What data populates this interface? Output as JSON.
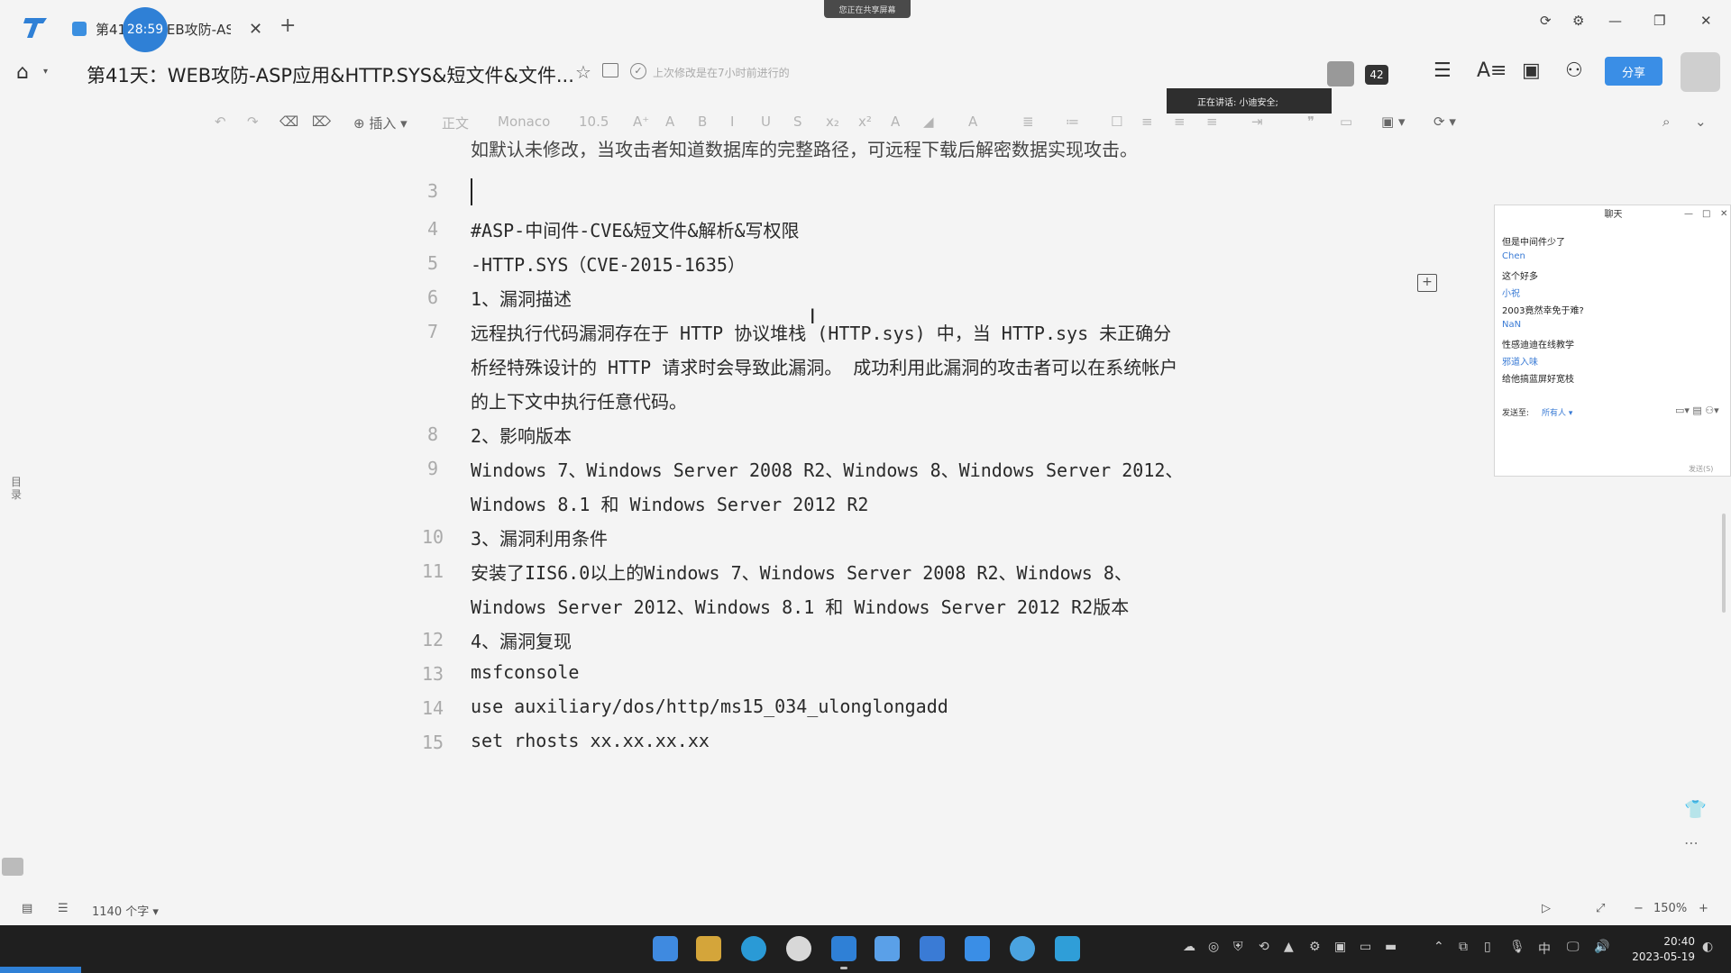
{
  "tabs": [
    {
      "title": "第41天：WEB攻防-ASP..."
    }
  ],
  "timer": "28:59",
  "share_indicator": "您正在共享屏幕",
  "doc": {
    "title": "第41天：WEB攻防-ASP应用&HTTP.SYS&短文件&文件...",
    "save_status": "上次修改是在7小时前进行的"
  },
  "speaking": "正在讲话: 小迪安全;",
  "participants_count": "42",
  "share_button": "分享",
  "toolbar": {
    "insert": "插入",
    "style": "正文",
    "font": "Monaco",
    "size": "10.5"
  },
  "editor": {
    "top_line": "如默认未修改，当攻击者知道数据库的完整路径，可远程下载后解密数据实现攻击。",
    "lines": [
      {
        "no": "3",
        "text": ""
      },
      {
        "no": "4",
        "text": "#ASP-中间件-CVE&短文件&解析&写权限"
      },
      {
        "no": "5",
        "text": "-HTTP.SYS（CVE-2015-1635）"
      },
      {
        "no": "6",
        "text": "1、漏洞描述"
      },
      {
        "no": "7",
        "text": "远程执行代码漏洞存在于 HTTP 协议堆栈 (HTTP.sys) 中，当 HTTP.sys 未正确分"
      },
      {
        "no": "",
        "text": "析经特殊设计的 HTTP 请求时会导致此漏洞。 成功利用此漏洞的攻击者可以在系统帐户"
      },
      {
        "no": "",
        "text": "的上下文中执行任意代码。"
      },
      {
        "no": "8",
        "text": "2、影响版本"
      },
      {
        "no": "9",
        "text": "Windows 7、Windows Server 2008 R2、Windows 8、Windows Server 2012、"
      },
      {
        "no": "",
        "text": "Windows 8.1 和 Windows Server 2012 R2"
      },
      {
        "no": "10",
        "text": "3、漏洞利用条件"
      },
      {
        "no": "11",
        "text": "安装了IIS6.0以上的Windows 7、Windows Server 2008 R2、Windows 8、"
      },
      {
        "no": "",
        "text": "Windows Server 2012、Windows 8.1 和 Windows Server 2012 R2版本"
      },
      {
        "no": "12",
        "text": "4、漏洞复现"
      },
      {
        "no": "13",
        "text": "msfconsole"
      },
      {
        "no": "14",
        "text": "use auxiliary/dos/http/ms15_034_ulonglongadd"
      },
      {
        "no": "15",
        "text": "set rhosts xx.xx.xx.xx"
      }
    ]
  },
  "side_label": "目录",
  "chat": {
    "title": "聊天",
    "messages": [
      {
        "text": "但是中间件少了",
        "is_name": false
      },
      {
        "text": "Chen",
        "is_name": true
      },
      {
        "text": "这个好多",
        "is_name": false
      },
      {
        "text": "小祝",
        "is_name": true
      },
      {
        "text": "2003竟然幸免于难?",
        "is_name": false
      },
      {
        "text": "NaN",
        "is_name": true
      },
      {
        "text": "性感迪迪在线教学",
        "is_name": false
      },
      {
        "text": "邪道入味",
        "is_name": true
      },
      {
        "text": "给他搞蓝屏好宽枝",
        "is_name": false
      }
    ],
    "send_to_label": "发送至:",
    "send_to_value": "所有人",
    "send_button": "发送(S)"
  },
  "statusbar": {
    "word_count": "1140 个字",
    "zoom": "150%"
  },
  "clock": {
    "time": "20:40",
    "date": "2023-05-19"
  },
  "tray_ime": "中",
  "colors": {
    "accent": "#3a8ee6",
    "timer": "#2f80d6",
    "taskbar": "#1f1f1f"
  }
}
